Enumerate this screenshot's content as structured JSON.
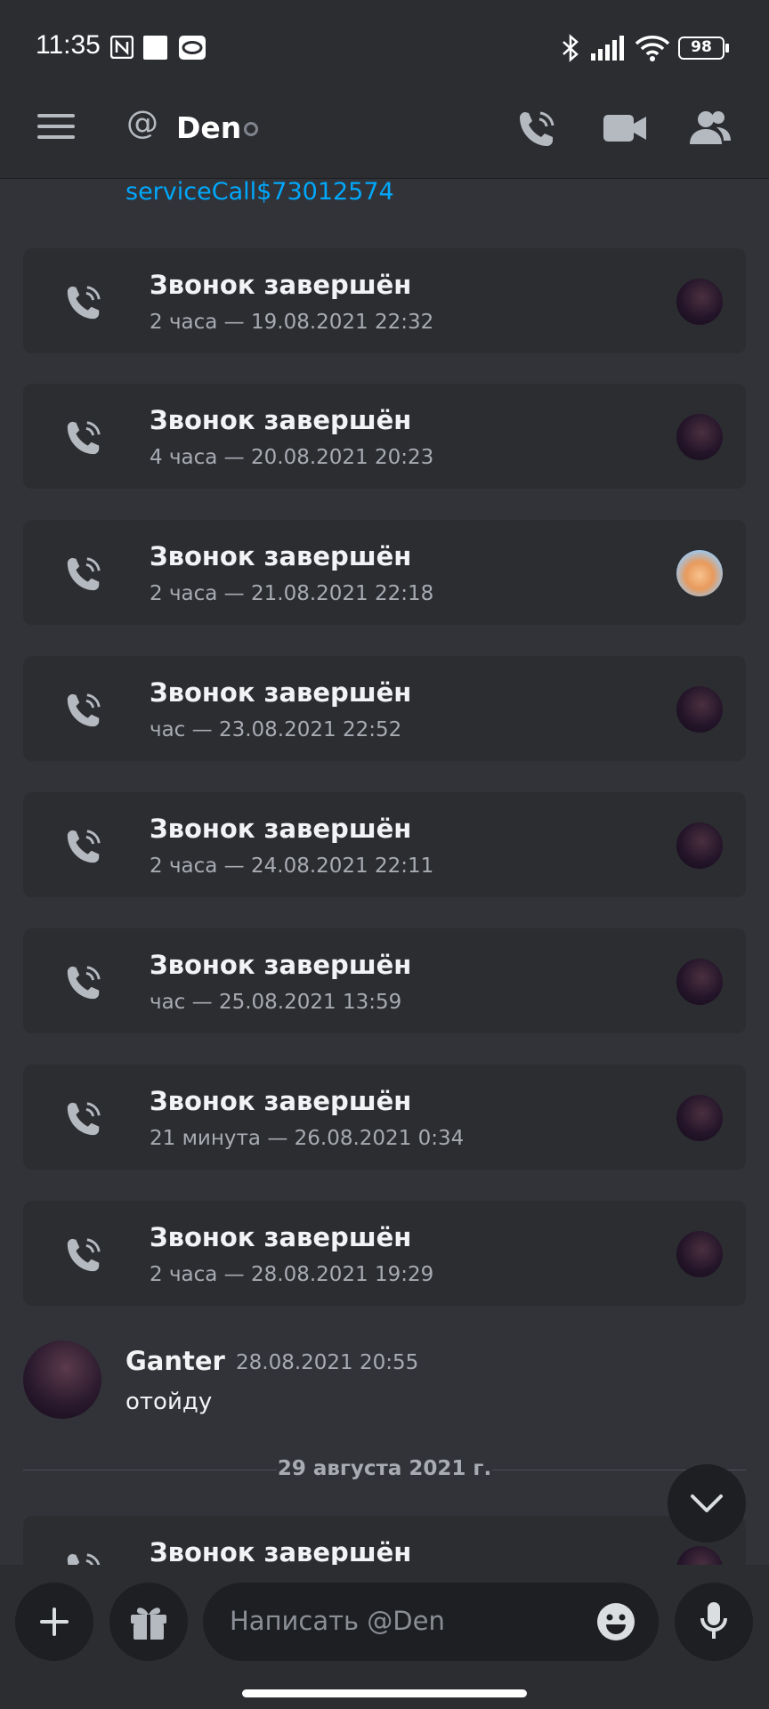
{
  "status_bar": {
    "time": "11:35",
    "battery": "98"
  },
  "header": {
    "at_symbol": "@",
    "title": "Den"
  },
  "link_text": "serviceCall$73012574",
  "calls": [
    {
      "title": "Звонок завершён",
      "subtitle": "2 часа — 19.08.2021 22:32"
    },
    {
      "title": "Звонок завершён",
      "subtitle": "4 часа — 20.08.2021 20:23"
    },
    {
      "title": "Звонок завершён",
      "subtitle": "2 часа — 21.08.2021 22:18"
    },
    {
      "title": "Звонок завершён",
      "subtitle": "час — 23.08.2021 22:52"
    },
    {
      "title": "Звонок завершён",
      "subtitle": "2 часа — 24.08.2021 22:11"
    },
    {
      "title": "Звонок завершён",
      "subtitle": "час — 25.08.2021 13:59"
    },
    {
      "title": "Звонок завершён",
      "subtitle": "21 минута — 26.08.2021 0:34"
    },
    {
      "title": "Звонок завершён",
      "subtitle": "2 часа — 28.08.2021 19:29"
    },
    {
      "title": "Звонок завершён",
      "subtitle": ""
    }
  ],
  "message": {
    "author": "Ganter",
    "timestamp": "28.08.2021 20:55",
    "text": "отойду"
  },
  "date_divider": "29 августа 2021 г.",
  "composer": {
    "placeholder": "Написать @Den"
  },
  "colors": {
    "background": "#313338",
    "card": "#2b2d31",
    "link": "#00a8fc",
    "input": "#1e1f22"
  }
}
